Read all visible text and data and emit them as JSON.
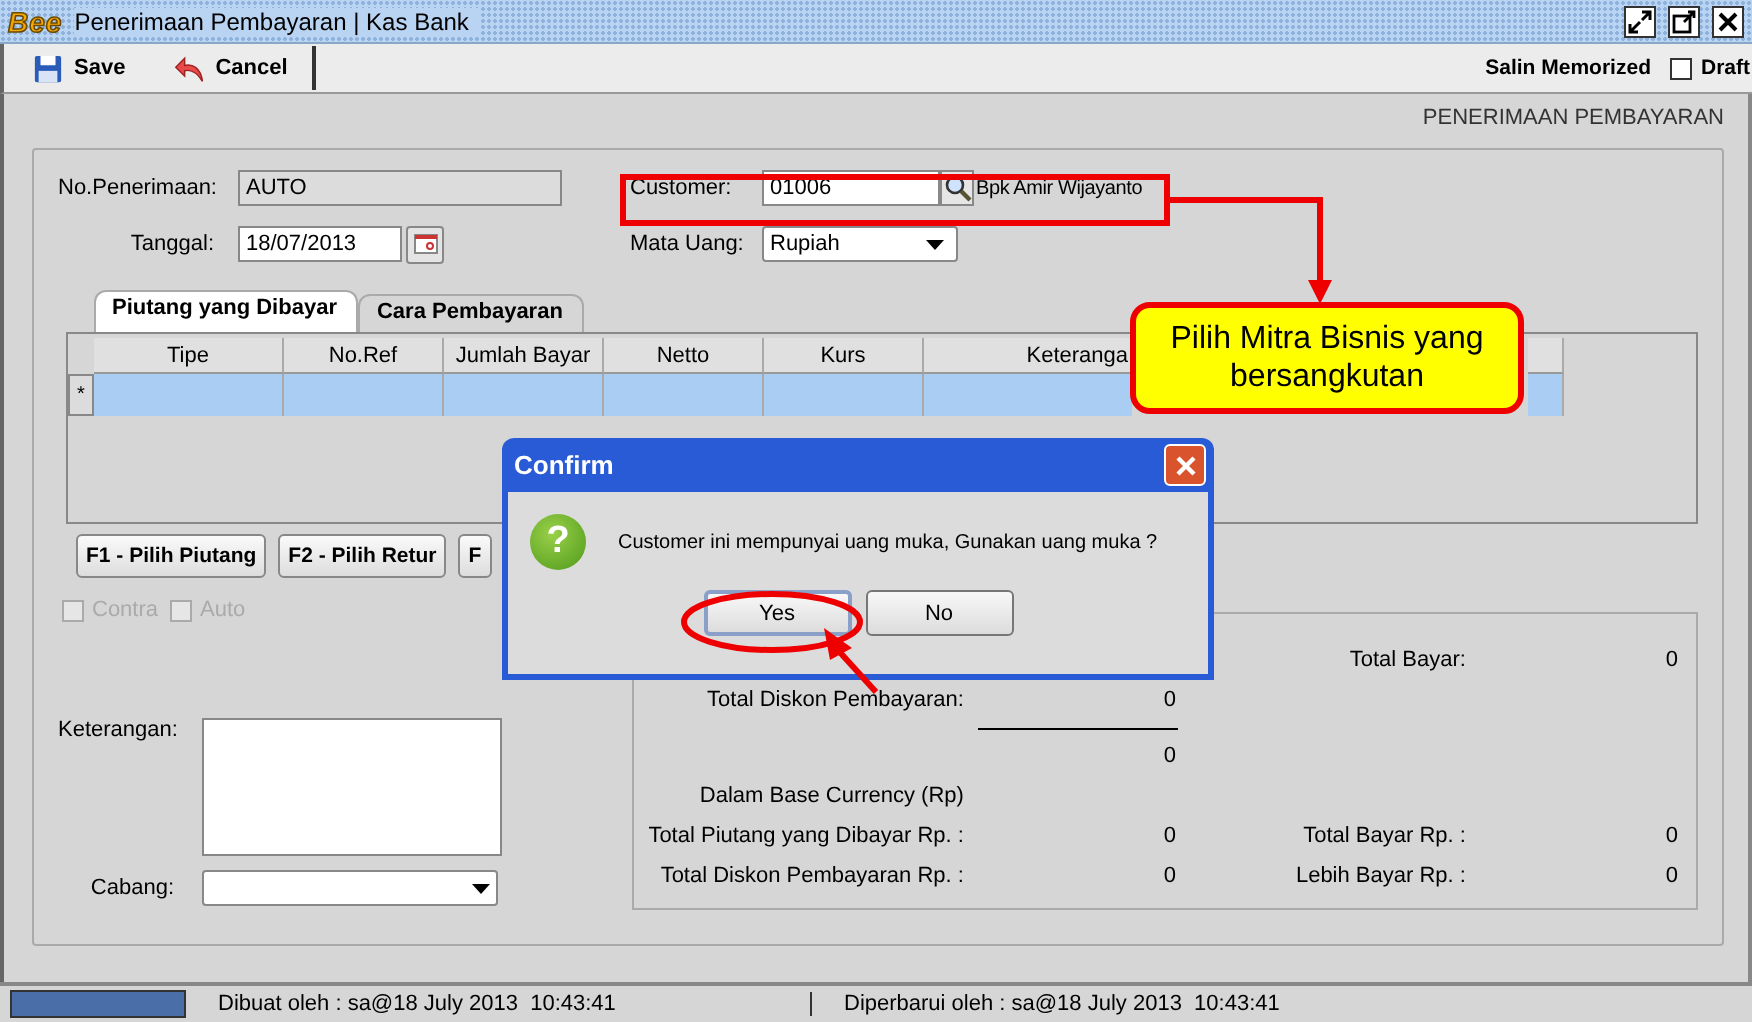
{
  "window": {
    "logo": "Bee",
    "title": "Penerimaan Pembayaran | Kas Bank"
  },
  "toolbar": {
    "buttons": [
      {
        "label": "Save",
        "kind": "save"
      },
      {
        "label": "Cancel",
        "kind": "cancel"
      }
    ],
    "copy_label": "Salin Memorized",
    "draft": {
      "label": "Draft",
      "checked": false
    }
  },
  "form_title": "PENERIMAAN PEMBAYARAN",
  "fields": {
    "receipt_no": {
      "label": "No.Penerimaan:",
      "value": "AUTO"
    },
    "date": {
      "label": "Tanggal:",
      "value": "18/07/2013"
    },
    "customer": {
      "label": "Customer:",
      "value": "01006",
      "name": "Bpk Amir Wijayanto"
    },
    "currency": {
      "label": "Mata Uang:",
      "value": "Rupiah"
    }
  },
  "tabs": [
    {
      "label": "Piutang yang Dibayar",
      "selected": true
    },
    {
      "label": "Cara Pembayaran",
      "selected": false
    }
  ],
  "grid": {
    "columns": [
      "Tipe",
      "No.Ref",
      "Jumlah Bayar",
      "Netto",
      "Kurs",
      "Keteranga"
    ],
    "rows": [
      {
        "marker": "*",
        "selected": true
      }
    ]
  },
  "actions": [
    "F1 - Pilih Piutang",
    "F2 - Pilih Retur",
    "F"
  ],
  "options": [
    {
      "label": "Contra",
      "checked": false,
      "disabled": true
    },
    {
      "label": "Auto",
      "checked": false,
      "disabled": true
    }
  ],
  "notes": {
    "label": "Keterangan:"
  },
  "branch": {
    "label": "Cabang:"
  },
  "summary": [
    {
      "kind": "values",
      "right_label": "Total Bayar:",
      "right_value": "0"
    },
    {
      "kind": "values",
      "left_label": "Total Diskon Pembayaran:",
      "left_value": "0"
    },
    {
      "kind": "rule"
    },
    {
      "kind": "values",
      "left_value": "0"
    },
    {
      "kind": "heading",
      "text": "Dalam Base Currency (Rp)"
    },
    {
      "kind": "values",
      "left_label": "Total Piutang yang Dibayar Rp. :",
      "left_value": "0",
      "right_label": "Total Bayar Rp. :",
      "right_value": "0"
    },
    {
      "kind": "values",
      "left_label": "Total Diskon Pembayaran Rp. :",
      "left_value": "0",
      "right_label": "Lebih Bayar Rp. :",
      "right_value": "0"
    }
  ],
  "status_bar": {
    "created": "Dibuat oleh : sa@18 July 2013  10:43:41",
    "updated": "Diperbarui oleh : sa@18 July 2013  10:43:41"
  },
  "callout": {
    "text": "Pilih Mitra Bisnis yang bersangkutan"
  },
  "dialog": {
    "title": "Confirm",
    "icon": "?",
    "message": "Customer ini mempunyai uang muka, Gunakan uang muka ?",
    "buttons": [
      {
        "label": "Yes",
        "selected": true
      },
      {
        "label": "No",
        "selected": false
      }
    ]
  }
}
